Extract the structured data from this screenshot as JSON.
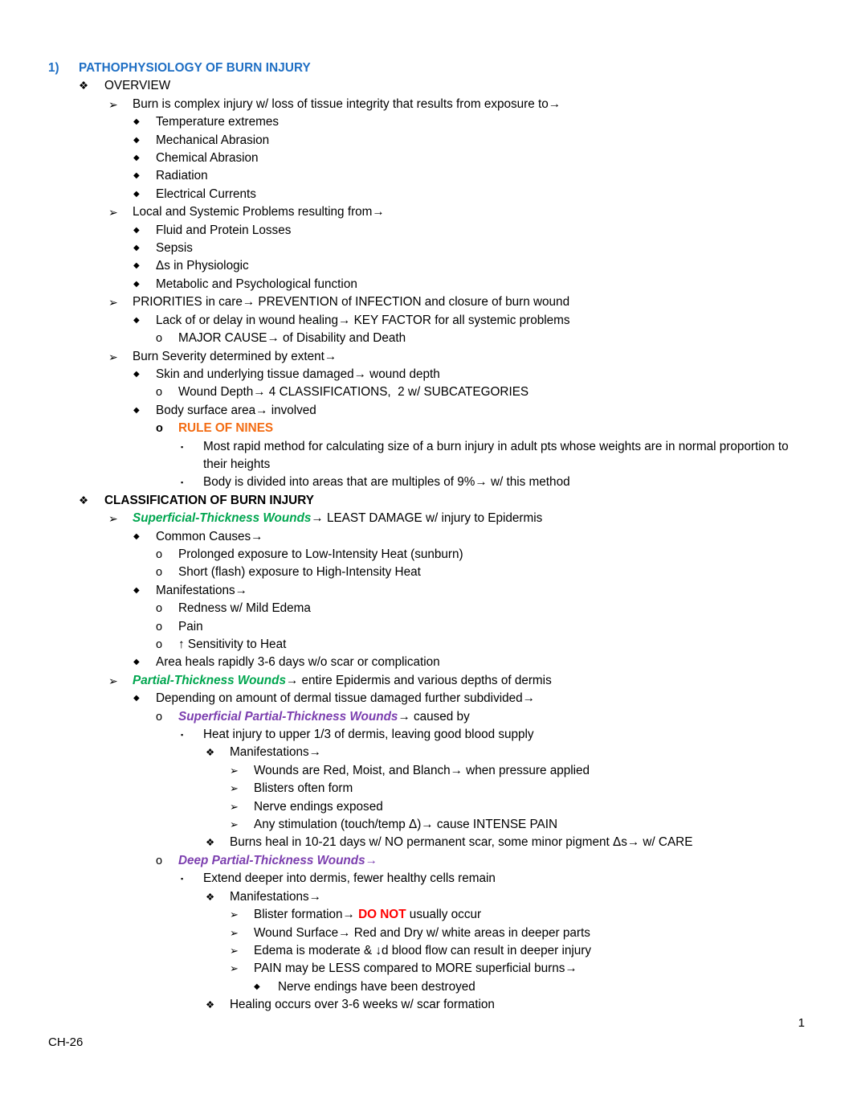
{
  "document": {
    "footer_chapter": "CH-26",
    "page_number": "1",
    "colors": {
      "heading_blue": "#1F6FC4",
      "accent_orange": "#F36C13",
      "accent_green": "#00A64F",
      "accent_purple": "#7C3FAF",
      "accent_red": "#FF0000"
    },
    "bullets": {
      "number": "1)",
      "flower": "❖",
      "arrow": "➢",
      "diamond": "◆",
      "circle_o": "o",
      "square": "▪"
    }
  },
  "outline": {
    "title": "PATHOPHYSIOLOGY OF BURN INJURY",
    "section_overview": {
      "label": "OVERVIEW",
      "burn_complex": "Burn is complex injury w/ loss of tissue integrity that results from exposure to→",
      "causes": [
        "Temperature extremes",
        "Mechanical Abrasion",
        "Chemical Abrasion",
        "Radiation",
        "Electrical Currents"
      ],
      "local_systemic": "Local and Systemic Problems resulting from→",
      "problems": [
        "Fluid and Protein Losses",
        "Sepsis",
        "Δs in Physiologic",
        "Metabolic and Psychological function"
      ],
      "priorities": "PRIORITIES in care→ PREVENTION of INFECTION and closure of burn wound",
      "lack_delay": "Lack of or delay in wound healing→ KEY FACTOR for all systemic problems",
      "major_cause": "MAJOR CAUSE→ of Disability and Death",
      "burn_severity": "Burn Severity determined by extent→",
      "skin_tissue": "Skin and underlying tissue damaged→ wound depth",
      "wound_depth": "Wound Depth→ 4 CLASSIFICATIONS,  2 w/ SUBCATEGORIES",
      "body_surface": "Body surface area→ involved",
      "rule_of_nines": "RULE OF NINES",
      "most_rapid": "Most rapid method for calculating size of a burn injury in adult pts whose weights are in normal proportion to their heights",
      "body_divided": "Body is divided into areas that are multiples of 9%→ w/ this method"
    },
    "section_classification": {
      "label": "CLASSIFICATION OF BURN INJURY",
      "superficial": {
        "term": "Superficial-Thickness Wounds",
        "rest": "→ LEAST DAMAGE w/ injury to Epidermis",
        "common_causes": "Common Causes→",
        "causes": [
          "Prolonged exposure to Low-Intensity Heat (sunburn)",
          "Short (flash) exposure to High-Intensity Heat"
        ],
        "manifestations": "Manifestations→",
        "manifestation_items": [
          "Redness w/ Mild Edema",
          "Pain",
          "↑ Sensitivity to Heat"
        ],
        "healing": "Area heals rapidly 3-6 days w/o scar or complication"
      },
      "partial": {
        "term": "Partial-Thickness Wounds",
        "rest": "→ entire Epidermis and various depths of dermis",
        "depending": "Depending on amount of dermal tissue damaged further subdivided→",
        "superficial_partial": {
          "term": "Superficial Partial-Thickness Wounds",
          "rest": "→ caused by",
          "heat_injury": "Heat injury to upper 1/3 of dermis, leaving good blood supply",
          "manifestations": "Manifestations→",
          "manifestation_items": [
            "Wounds are Red, Moist, and Blanch→ when pressure applied",
            "Blisters often form",
            "Nerve endings exposed",
            "Any stimulation (touch/temp Δ)→ cause INTENSE PAIN"
          ],
          "healing": "Burns heal in 10-21 days w/ NO permanent scar, some minor pigment Δs→ w/ CARE"
        },
        "deep_partial": {
          "term": "Deep Partial-Thickness Wounds",
          "rest": "→",
          "extend_deeper": "Extend deeper into dermis, fewer healthy cells remain",
          "manifestations": "Manifestations→",
          "blister_pre": "Blister formation→ ",
          "blister_emphasis": "DO NOT",
          "blister_post": " usually occur",
          "wound_surface": "Wound Surface→ Red and Dry w/ white areas in deeper parts",
          "edema": "Edema is moderate & ↓d blood flow can result in deeper injury",
          "pain": "PAIN may be LESS compared to MORE superficial burns→",
          "nerve_endings": "Nerve endings have been destroyed",
          "healing": "Healing occurs over 3-6 weeks w/ scar formation"
        }
      }
    }
  }
}
